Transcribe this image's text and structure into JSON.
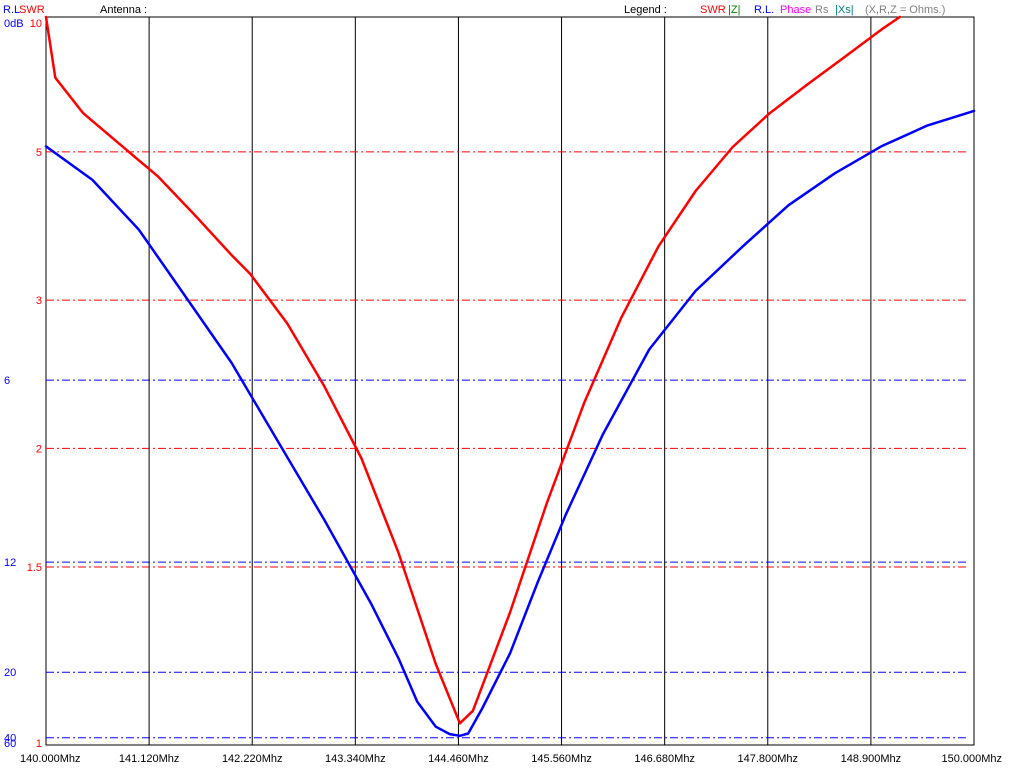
{
  "header": {
    "rl_label": "R.L",
    "swr_label": "SWR",
    "title": "Antenna :",
    "legend_label": "Legend :",
    "legend_items": [
      {
        "text": "SWR",
        "color": "#ff0000"
      },
      {
        "text": "|Z|",
        "color": "#008000"
      },
      {
        "text": "R.L.",
        "color": "#0000ff"
      },
      {
        "text": "Phase",
        "color": "#ff00ff"
      },
      {
        "text": "Rs",
        "color": "#808080"
      },
      {
        "text": "|Xs|",
        "color": "#008080"
      },
      {
        "text": "(X,R,Z = Ohms.)",
        "color": "#808080"
      }
    ]
  },
  "colors": {
    "swr": "#ff0000",
    "rl": "#0000ff",
    "grid": "#000000",
    "axis_text": "#000000"
  },
  "chart_data": {
    "type": "line",
    "x_unit": "Mhz",
    "x_range": [
      140.0,
      150.0
    ],
    "x_ticks": [
      "140.000Mhz",
      "141.120Mhz",
      "142.220Mhz",
      "143.340Mhz",
      "144.460Mhz",
      "145.560Mhz",
      "146.680Mhz",
      "147.800Mhz",
      "148.900Mhz",
      "150.000Mhz"
    ],
    "rl_axis": {
      "ticks": [
        "0dB",
        "6",
        "12",
        "20",
        "40",
        "60"
      ],
      "gridlines": [
        6,
        12,
        20,
        40
      ]
    },
    "swr_axis": {
      "ticks": [
        "10",
        "5",
        "3",
        "2",
        "1.5",
        "1"
      ],
      "gridlines": [
        5,
        3,
        2,
        1.5
      ]
    },
    "series": [
      {
        "name": "SWR",
        "color": "#ff0000",
        "points": [
          [
            140.0,
            10
          ],
          [
            140.1,
            7.0
          ],
          [
            140.4,
            5.9
          ],
          [
            140.8,
            5.15
          ],
          [
            141.2,
            4.55
          ],
          [
            141.6,
            3.95
          ],
          [
            142.0,
            3.45
          ],
          [
            142.2,
            3.25
          ],
          [
            142.6,
            2.8
          ],
          [
            143.0,
            2.35
          ],
          [
            143.4,
            1.95
          ],
          [
            143.8,
            1.55
          ],
          [
            144.2,
            1.2
          ],
          [
            144.46,
            1.05
          ],
          [
            144.6,
            1.08
          ],
          [
            145.0,
            1.35
          ],
          [
            145.4,
            1.75
          ],
          [
            145.8,
            2.25
          ],
          [
            146.2,
            2.85
          ],
          [
            146.6,
            3.55
          ],
          [
            147.0,
            4.3
          ],
          [
            147.4,
            5.1
          ],
          [
            147.8,
            5.9
          ],
          [
            148.2,
            6.75
          ],
          [
            148.6,
            7.8
          ],
          [
            149.0,
            9.2
          ],
          [
            149.2,
            10
          ]
        ]
      },
      {
        "name": "R.L.",
        "color": "#0000ff",
        "points": [
          [
            140.0,
            1.7
          ],
          [
            140.5,
            2.2
          ],
          [
            141.0,
            3.0
          ],
          [
            141.5,
            4.2
          ],
          [
            142.0,
            5.6
          ],
          [
            142.5,
            7.6
          ],
          [
            143.0,
            10.2
          ],
          [
            143.5,
            14.2
          ],
          [
            143.8,
            18.5
          ],
          [
            144.0,
            24.5
          ],
          [
            144.2,
            32.0
          ],
          [
            144.35,
            36.5
          ],
          [
            144.46,
            38.0
          ],
          [
            144.55,
            36.0
          ],
          [
            144.7,
            26.0
          ],
          [
            145.0,
            18.0
          ],
          [
            145.3,
            13.0
          ],
          [
            145.6,
            10.0
          ],
          [
            146.0,
            7.4
          ],
          [
            146.5,
            5.3
          ],
          [
            147.0,
            4.1
          ],
          [
            147.5,
            3.3
          ],
          [
            148.0,
            2.6
          ],
          [
            148.5,
            2.1
          ],
          [
            149.0,
            1.7
          ],
          [
            149.5,
            1.4
          ],
          [
            150.0,
            1.2
          ]
        ]
      }
    ]
  }
}
